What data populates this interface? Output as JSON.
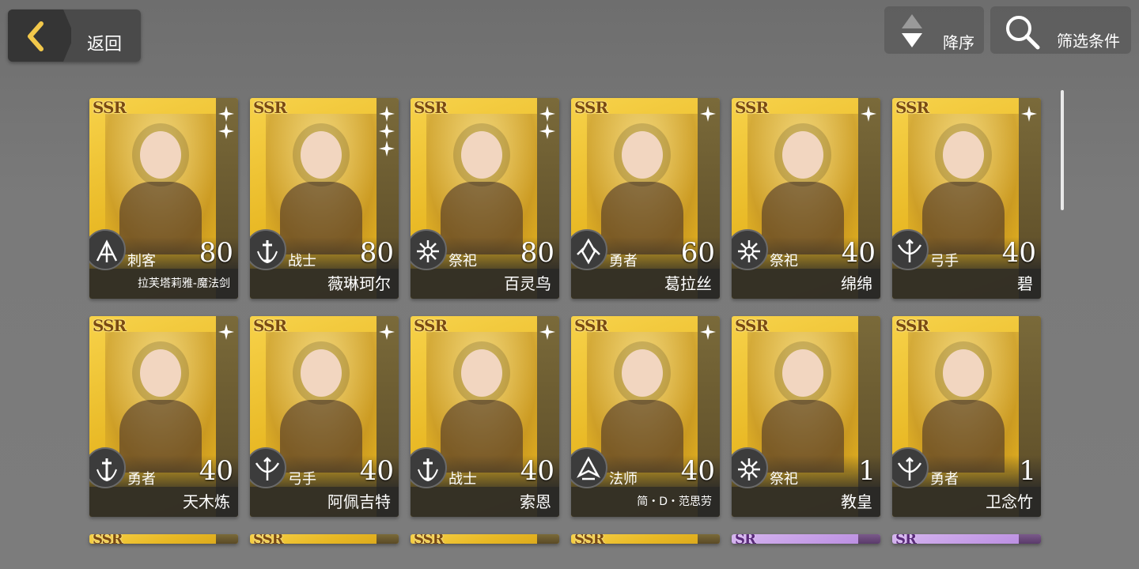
{
  "header": {
    "back_label": "返回",
    "sort_label": "降序",
    "filter_label": "筛选条件"
  },
  "cards": [
    {
      "rarity": "SSR",
      "stars": 2,
      "class": "刺客",
      "class_icon": "assassin-icon",
      "level": "80",
      "name": "拉芙塔莉雅-魔法剑"
    },
    {
      "rarity": "SSR",
      "stars": 3,
      "class": "战士",
      "class_icon": "warrior-icon",
      "level": "80",
      "name": "薇琳珂尔"
    },
    {
      "rarity": "SSR",
      "stars": 2,
      "class": "祭祀",
      "class_icon": "priest-icon",
      "level": "80",
      "name": "百灵鸟"
    },
    {
      "rarity": "SSR",
      "stars": 1,
      "class": "勇者",
      "class_icon": "hero-icon",
      "level": "60",
      "name": "葛拉丝"
    },
    {
      "rarity": "SSR",
      "stars": 1,
      "class": "祭祀",
      "class_icon": "priest-icon",
      "level": "40",
      "name": "绵绵"
    },
    {
      "rarity": "SSR",
      "stars": 1,
      "class": "弓手",
      "class_icon": "archer-icon",
      "level": "40",
      "name": "碧"
    },
    {
      "rarity": "SSR",
      "stars": 1,
      "class": "勇者",
      "class_icon": "warrior-icon",
      "level": "40",
      "name": "天木炼"
    },
    {
      "rarity": "SSR",
      "stars": 1,
      "class": "弓手",
      "class_icon": "archer-icon",
      "level": "40",
      "name": "阿佩吉特"
    },
    {
      "rarity": "SSR",
      "stars": 1,
      "class": "战士",
      "class_icon": "warrior-icon",
      "level": "40",
      "name": "索恩"
    },
    {
      "rarity": "SSR",
      "stars": 1,
      "class": "法师",
      "class_icon": "mage-icon",
      "level": "40",
      "name": "简・D・范思劳"
    },
    {
      "rarity": "SSR",
      "stars": 0,
      "class": "祭祀",
      "class_icon": "priest-icon",
      "level": "1",
      "name": "教皇"
    },
    {
      "rarity": "SSR",
      "stars": 0,
      "class": "勇者",
      "class_icon": "archer-icon",
      "level": "1",
      "name": "卫念竹"
    }
  ],
  "partial_row": [
    "SSR",
    "SSR",
    "SSR",
    "SSR",
    "SR",
    "SR"
  ],
  "colors": {
    "ssr_gold": "#e8b824",
    "sr_purple": "#b88ae0",
    "background": "#777777"
  }
}
